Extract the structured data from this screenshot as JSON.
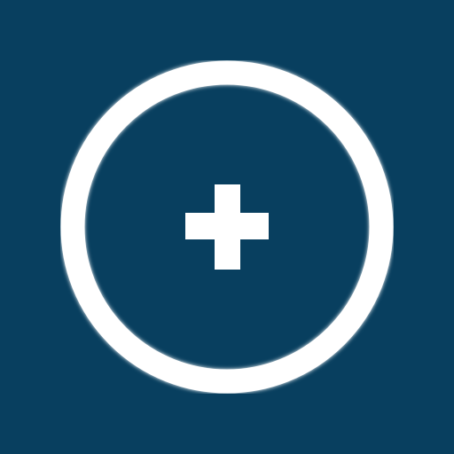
{
  "app": {
    "background_color": "#083f5f",
    "foreground_color": "#ffffff"
  },
  "icons": {
    "ring": "circle-outline-icon",
    "center": "plus-icon"
  }
}
